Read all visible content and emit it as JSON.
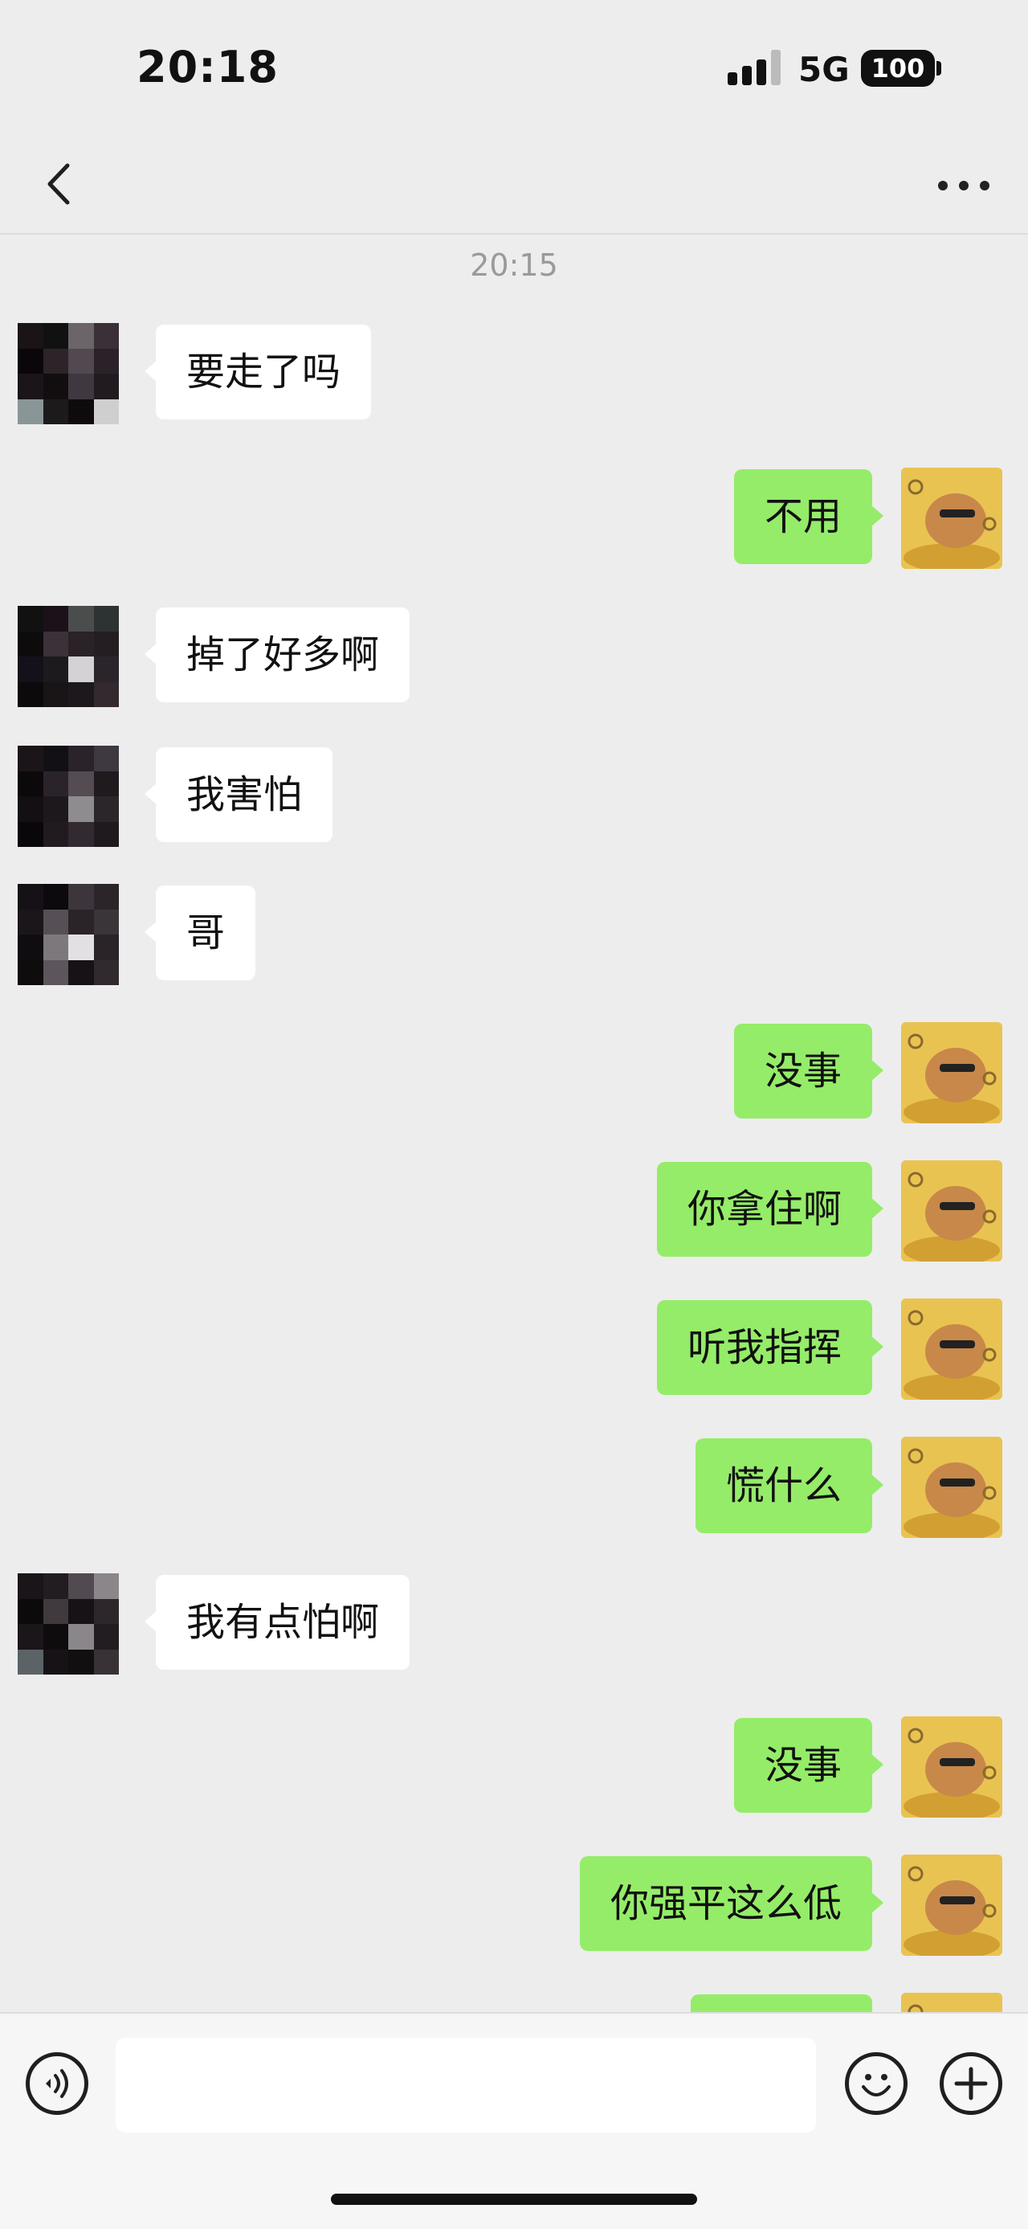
{
  "status_bar": {
    "time": "20:18",
    "network": "5G",
    "battery": "100"
  },
  "header": {
    "title": ""
  },
  "chat": {
    "timestamp": "20:15",
    "messages": [
      {
        "side": "in",
        "text": "要走了吗"
      },
      {
        "side": "out",
        "text": "不用"
      },
      {
        "side": "in",
        "text": "掉了好多啊"
      },
      {
        "side": "in",
        "text": "我害怕"
      },
      {
        "side": "in",
        "text": "哥"
      },
      {
        "side": "out",
        "text": "没事"
      },
      {
        "side": "out",
        "text": "你拿住啊"
      },
      {
        "side": "out",
        "text": "听我指挥"
      },
      {
        "side": "out",
        "text": "慌什么"
      },
      {
        "side": "in",
        "text": "我有点怕啊"
      },
      {
        "side": "out",
        "text": "没事"
      },
      {
        "side": "out",
        "text": "你强平这么低"
      },
      {
        "side": "out",
        "text": ""
      }
    ]
  },
  "input": {
    "placeholder": ""
  },
  "colors": {
    "background": "#ededed",
    "incoming_bubble": "#ffffff",
    "outgoing_bubble": "#95ec69",
    "text": "#111111",
    "timestamp": "#9a9a9a"
  },
  "icons": {
    "back": "chevron-left-icon",
    "more": "more-dots-icon",
    "voice": "voice-icon",
    "emoji": "emoji-icon",
    "plus": "plus-icon"
  }
}
